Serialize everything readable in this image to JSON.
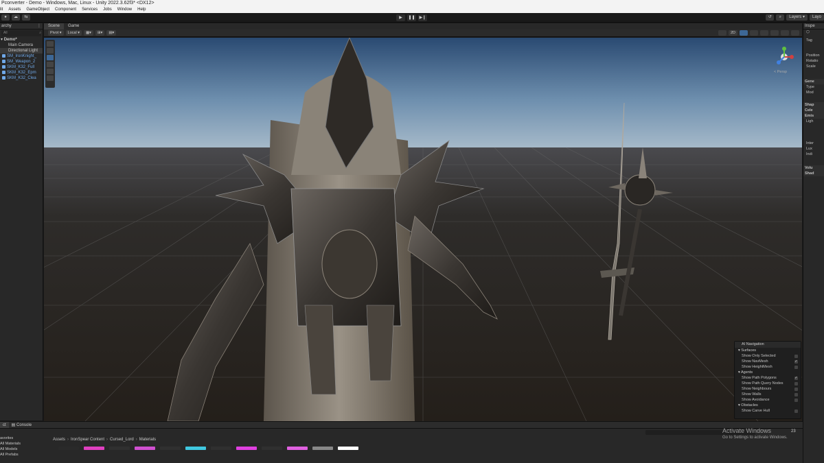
{
  "window": {
    "title": "Pconverter - Demo - Windows, Mac, Linux - Unity 2022.3.62f3* <DX12>"
  },
  "menu": [
    "lit",
    "Assets",
    "GameObject",
    "Component",
    "Services",
    "Jobs",
    "Window",
    "Help"
  ],
  "toolbar": {
    "play_icon": "▶",
    "pause_icon": "❚❚",
    "step_icon": "▶❙",
    "layers_label": "Layers",
    "layout_label": "Layo"
  },
  "hierarchy": {
    "tab_label": "archy",
    "search_placeholder": "All",
    "scene_name": "Demo*",
    "items": [
      {
        "label": "Main Camera",
        "type": "child"
      },
      {
        "label": "Directional Light",
        "type": "child"
      },
      {
        "label": "SM_IronKnight_",
        "type": "prefab"
      },
      {
        "label": "SM_Weapon_2",
        "type": "prefab"
      },
      {
        "label": "SKM_K32_Full",
        "type": "prefab"
      },
      {
        "label": "SKM_K32_Epm",
        "type": "prefab"
      },
      {
        "label": "SKM_K32_Clea",
        "type": "prefab"
      }
    ]
  },
  "scene_view": {
    "tabs": [
      "Scene",
      "Game"
    ],
    "pivot_label": "Pivot",
    "local_label": "Local",
    "mode_2d": "2D",
    "persp_label": "< Persp"
  },
  "ai_navigation": {
    "title": "AI Navigation",
    "sections": [
      {
        "name": "Surfaces",
        "rows": [
          {
            "label": "Show Only Selected",
            "checked": false
          },
          {
            "label": "Show NavMesh",
            "checked": true
          },
          {
            "label": "Show HeightMesh",
            "checked": false
          }
        ]
      },
      {
        "name": "Agents",
        "rows": [
          {
            "label": "Show Path Polygons",
            "checked": true
          },
          {
            "label": "Show Path Query Nodes",
            "checked": false
          },
          {
            "label": "Show Neighbours",
            "checked": false
          },
          {
            "label": "Show Walls",
            "checked": false
          },
          {
            "label": "Show Avoidance",
            "checked": false
          }
        ]
      },
      {
        "name": "Obstacles",
        "rows": [
          {
            "label": "Show Carve Hull",
            "checked": false
          }
        ]
      }
    ]
  },
  "inspector": {
    "tab_label": "Inspe",
    "rows": [
      "Tag",
      "Position",
      "Rotatio",
      "Scale",
      "Gene",
      "Type",
      "Mod",
      "Shap",
      "Cele",
      "Emis",
      "Ligh",
      "Inter",
      "Lux",
      "Indi",
      "Volu",
      "Shad"
    ]
  },
  "bottom": {
    "tabs": [
      "ct",
      "Console"
    ],
    "favorites": [
      "avorites",
      "All Materials",
      "All Models",
      "All Prefabs"
    ],
    "breadcrumb": [
      "Assets",
      "IronSpear Content",
      "Cursed_Lord",
      "Materials"
    ],
    "count_label": "23",
    "thumb_colors": [
      "#2a2a2a",
      "#e040c0",
      "#303030",
      "#d050d0",
      "#303030",
      "#40c8e0",
      "#303030",
      "#e040e0",
      "#303030",
      "#e060e0",
      "#888888",
      "#ffffff"
    ]
  },
  "watermark": {
    "line1": "Activate Windows",
    "line2": "Go to Settings to activate Windows."
  }
}
